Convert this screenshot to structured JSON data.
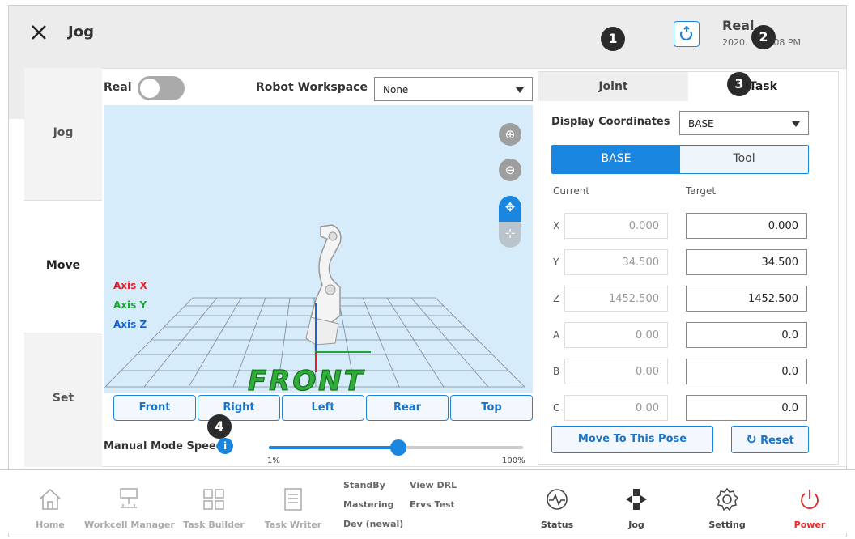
{
  "header": {
    "title": "Jog",
    "right_label": "Real",
    "datetime": "2020.  3:54:08 PM"
  },
  "badges": [
    "1",
    "2",
    "3",
    "4"
  ],
  "sidebar": {
    "items": [
      {
        "label": "Jog"
      },
      {
        "label": "Move"
      },
      {
        "label": "Set"
      }
    ]
  },
  "controls": {
    "real_label": "Real",
    "real_on": false,
    "workspace_label": "Robot Workspace",
    "workspace_value": "None"
  },
  "view3d": {
    "axis_x": "Axis X",
    "axis_y": "Axis Y",
    "axis_z": "Axis Z",
    "floor_text": "FRONT",
    "buttons": [
      "Front",
      "Right",
      "Left",
      "Rear",
      "Top"
    ],
    "colors": {
      "axis_x": "#e0202a",
      "axis_y": "#1fa33a",
      "axis_z": "#1a66d0"
    }
  },
  "speed": {
    "label": "Manual Mode Speed",
    "min_label": "1%",
    "max_label": "100%",
    "value_fraction": 0.51
  },
  "panel": {
    "tabs": [
      {
        "label": "Joint"
      },
      {
        "label": "Task"
      }
    ],
    "display_coords_label": "Display Coordinates",
    "display_coords_value": "BASE",
    "segment": [
      "BASE",
      "Tool"
    ],
    "current_label": "Current",
    "target_label": "Target",
    "rows": [
      {
        "axis": "X",
        "current": "0.000",
        "target": "0.000"
      },
      {
        "axis": "Y",
        "current": "34.500",
        "target": "34.500"
      },
      {
        "axis": "Z",
        "current": "1452.500",
        "target": "1452.500"
      },
      {
        "axis": "A",
        "current": "0.00",
        "target": "0.0"
      },
      {
        "axis": "B",
        "current": "0.00",
        "target": "0.0"
      },
      {
        "axis": "C",
        "current": "0.00",
        "target": "0.0"
      }
    ],
    "move_label": "Move To This Pose",
    "reset_label": "Reset"
  },
  "bottom": {
    "home": "Home",
    "workcell": "Workcell Manager",
    "task_builder": "Task Builder",
    "task_writer": "Task Writer",
    "menu": [
      "StandBy",
      "View DRL",
      "Mastering",
      "Ervs Test",
      "Dev (newal)"
    ],
    "status": "Status",
    "jog": "Jog",
    "setting": "Setting",
    "power": "Power",
    "accent": "#1a86e0",
    "power_color": "#e02a2a"
  }
}
